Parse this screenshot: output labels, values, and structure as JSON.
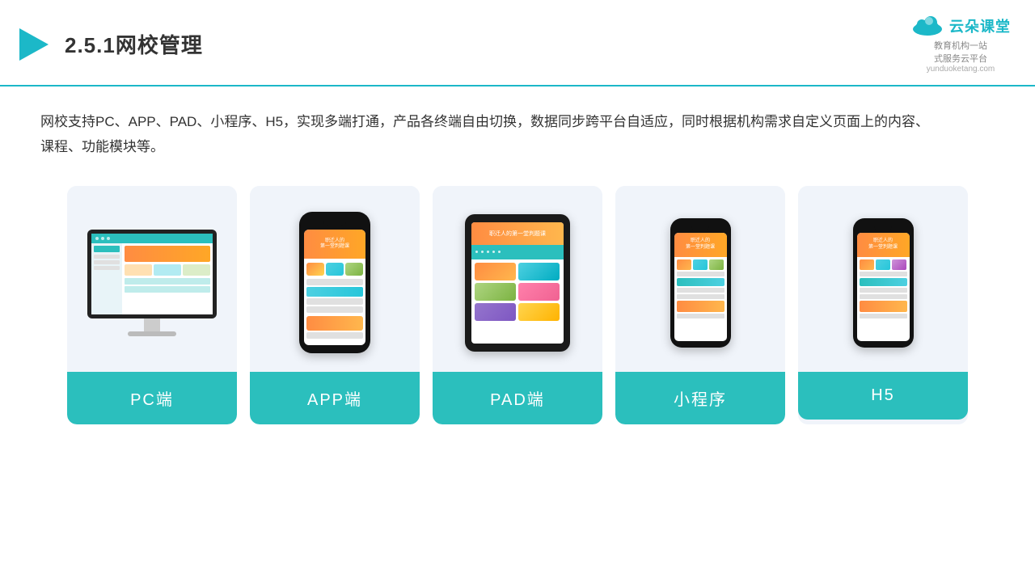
{
  "header": {
    "title": "2.5.1网校管理",
    "logo_main": "云朵课堂",
    "logo_url_text": "yunduoketang.com",
    "logo_sub1": "教育机构一站",
    "logo_sub2": "式服务云平台"
  },
  "description": "网校支持PC、APP、PAD、小程序、H5，实现多端打通，产品各终端自由切换，数据同步跨平台自适应，同时根据机构需求自定义页面上的内容、课程、功能模块等。",
  "cards": [
    {
      "id": "pc",
      "label": "PC端"
    },
    {
      "id": "app",
      "label": "APP端"
    },
    {
      "id": "pad",
      "label": "PAD端"
    },
    {
      "id": "miniprogram",
      "label": "小程序"
    },
    {
      "id": "h5",
      "label": "H5"
    }
  ],
  "accent_color": "#2bbfbd"
}
